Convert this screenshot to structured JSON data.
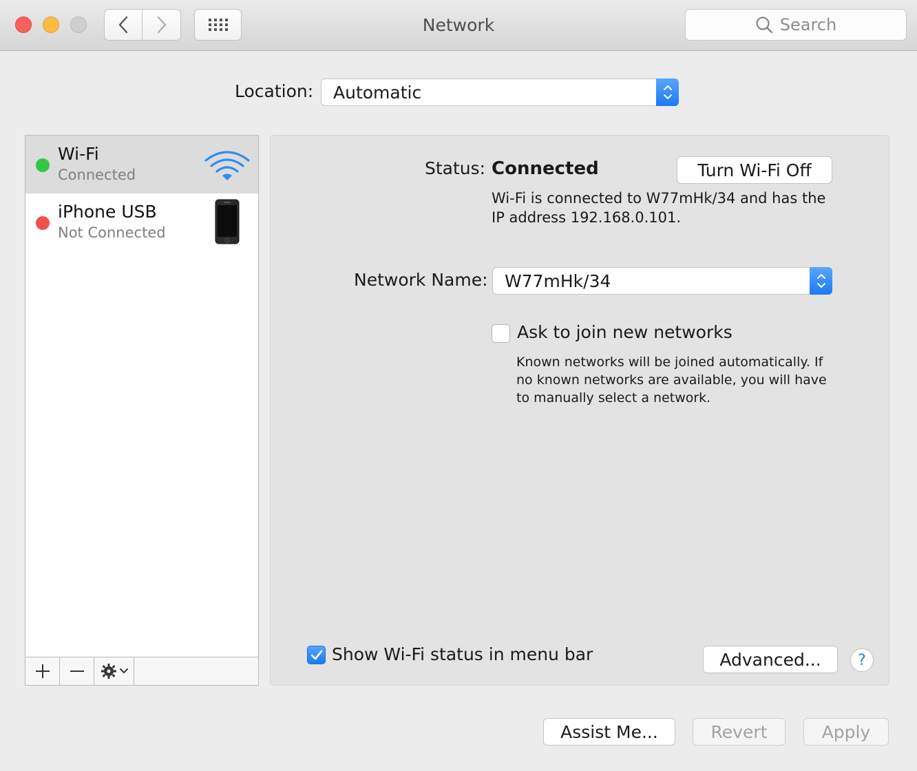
{
  "window": {
    "title": "Network",
    "search_placeholder": "Search"
  },
  "location": {
    "label": "Location:",
    "value": "Automatic"
  },
  "services": [
    {
      "name": "Wi-Fi",
      "status": "Connected",
      "status_color": "#33c748",
      "selected": true,
      "icon": "wifi-icon"
    },
    {
      "name": "iPhone USB",
      "status": "Not Connected",
      "status_color": "#f2504c",
      "selected": false,
      "icon": "iphone-icon"
    }
  ],
  "detail": {
    "status_label": "Status:",
    "status_value": "Connected",
    "status_description": "Wi-Fi is connected to W77mHk/34 and has the IP address 192.168.0.101.",
    "turn_off_button": "Turn Wi-Fi Off",
    "network_name_label": "Network Name:",
    "network_name_value": "W77mHk/34",
    "ask_to_join_label": "Ask to join new networks",
    "ask_to_join_checked": false,
    "ask_to_join_description": "Known networks will be joined automatically. If no known networks are available, you will have to manually select a network.",
    "show_status_label": "Show Wi-Fi status in menu bar",
    "show_status_checked": true,
    "advanced_button": "Advanced...",
    "help_button": "?"
  },
  "footer": {
    "assist_button": "Assist Me...",
    "revert_button": "Revert",
    "apply_button": "Apply"
  },
  "colors": {
    "accent": "#1c7af4",
    "wifi_icon": "#2d8cf0"
  }
}
